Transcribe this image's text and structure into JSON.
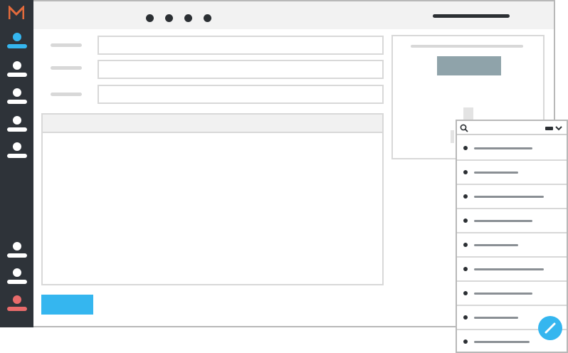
{
  "app": {
    "logo_glyph": "M",
    "logo_color": "#e36b3c"
  },
  "sidebar": {
    "items": [
      {
        "name": "user-1",
        "active": true,
        "color": "#35b6ef"
      },
      {
        "name": "user-2"
      },
      {
        "name": "user-3"
      },
      {
        "name": "user-4"
      },
      {
        "name": "user-5"
      },
      {
        "name": "user-6"
      },
      {
        "name": "user-7"
      },
      {
        "name": "user-8",
        "active": true,
        "color": "#e86b6b"
      }
    ]
  },
  "window": {
    "title_dots": 4
  },
  "form": {
    "fields": [
      {
        "label": "",
        "value": ""
      },
      {
        "label": "",
        "value": ""
      },
      {
        "label": "",
        "value": ""
      }
    ],
    "textarea": {
      "value": ""
    },
    "submit_label": ""
  },
  "side_panel": {
    "button_label": ""
  },
  "dropdown": {
    "search_icon": "search-icon",
    "items_count": 9
  },
  "fab": {
    "icon": "pencil-icon"
  },
  "colors": {
    "accent": "#35b6ef",
    "sidebar_bg": "#2e3339",
    "danger": "#e86b6b",
    "muted_button": "#8fa3aa"
  }
}
